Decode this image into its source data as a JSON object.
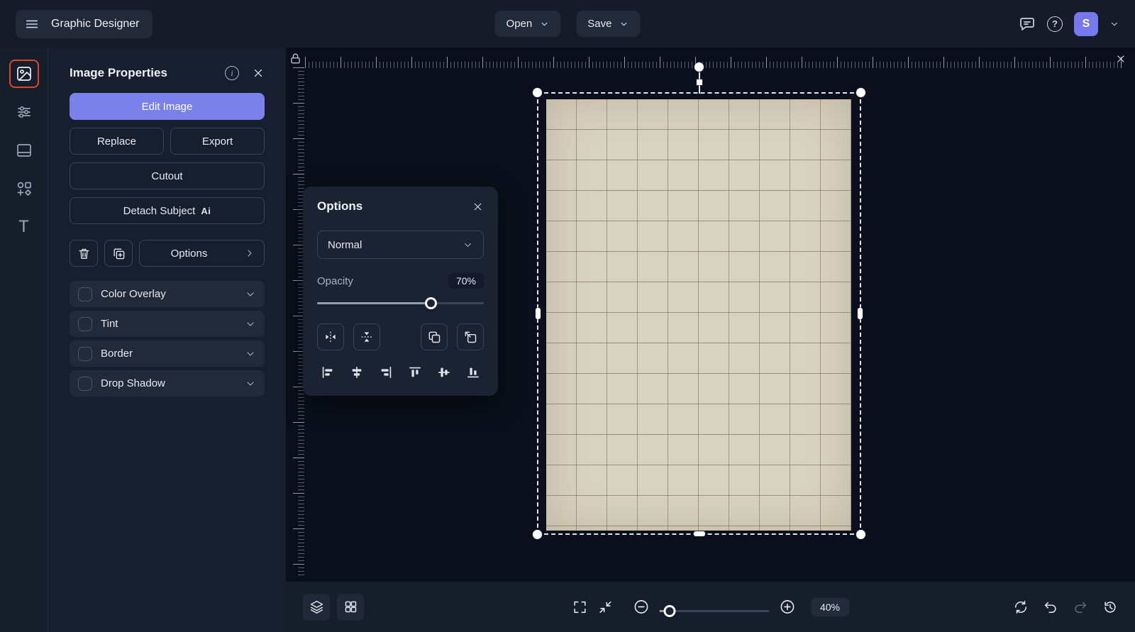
{
  "topbar": {
    "app_title": "Graphic Designer",
    "open_label": "Open",
    "save_label": "Save",
    "avatar_initial": "S"
  },
  "sidebar": {
    "active_tool": "image",
    "tools": [
      "image",
      "adjustments",
      "templates",
      "shapes",
      "text"
    ]
  },
  "panel": {
    "title": "Image Properties",
    "edit_image_label": "Edit Image",
    "replace_label": "Replace",
    "export_label": "Export",
    "cutout_label": "Cutout",
    "detach_subject_label": "Detach Subject",
    "detach_badge": "Ai",
    "options_label": "Options",
    "toggles": [
      {
        "label": "Color Overlay",
        "checked": false
      },
      {
        "label": "Tint",
        "checked": false
      },
      {
        "label": "Border",
        "checked": false
      },
      {
        "label": "Drop Shadow",
        "checked": false
      }
    ]
  },
  "options_popup": {
    "title": "Options",
    "blend_mode": "Normal",
    "opacity_label": "Opacity",
    "opacity_value": "70%",
    "opacity_percent": 70
  },
  "bottombar": {
    "zoom_value": "40%",
    "zoom_percent": 40
  },
  "colors": {
    "accent": "#7b81ea",
    "active_tool_outline": "#e0452c",
    "topbar_bg": "#151b29",
    "panel_bg": "#171e2d",
    "canvas_bg": "#0a0f1b",
    "paper": "#d8d2c0"
  },
  "icon_names": [
    "menu-icon",
    "chat-icon",
    "help-icon",
    "chevron-down-icon",
    "image-icon",
    "adjustments-icon",
    "templates-icon",
    "shapes-icon",
    "text-icon",
    "info-icon",
    "close-icon",
    "trash-icon",
    "duplicate-icon",
    "chevron-right-icon",
    "flip-horizontal-icon",
    "flip-vertical-icon",
    "bring-forward-icon",
    "send-backward-icon",
    "align-left-icon",
    "align-center-horizontal-icon",
    "align-right-icon",
    "align-top-icon",
    "align-middle-vertical-icon",
    "align-bottom-icon",
    "layers-icon",
    "grid-icon",
    "fullscreen-icon",
    "fit-screen-icon",
    "zoom-out-icon",
    "zoom-in-icon",
    "reset-icon",
    "undo-icon",
    "redo-icon",
    "history-icon",
    "lock-icon"
  ]
}
